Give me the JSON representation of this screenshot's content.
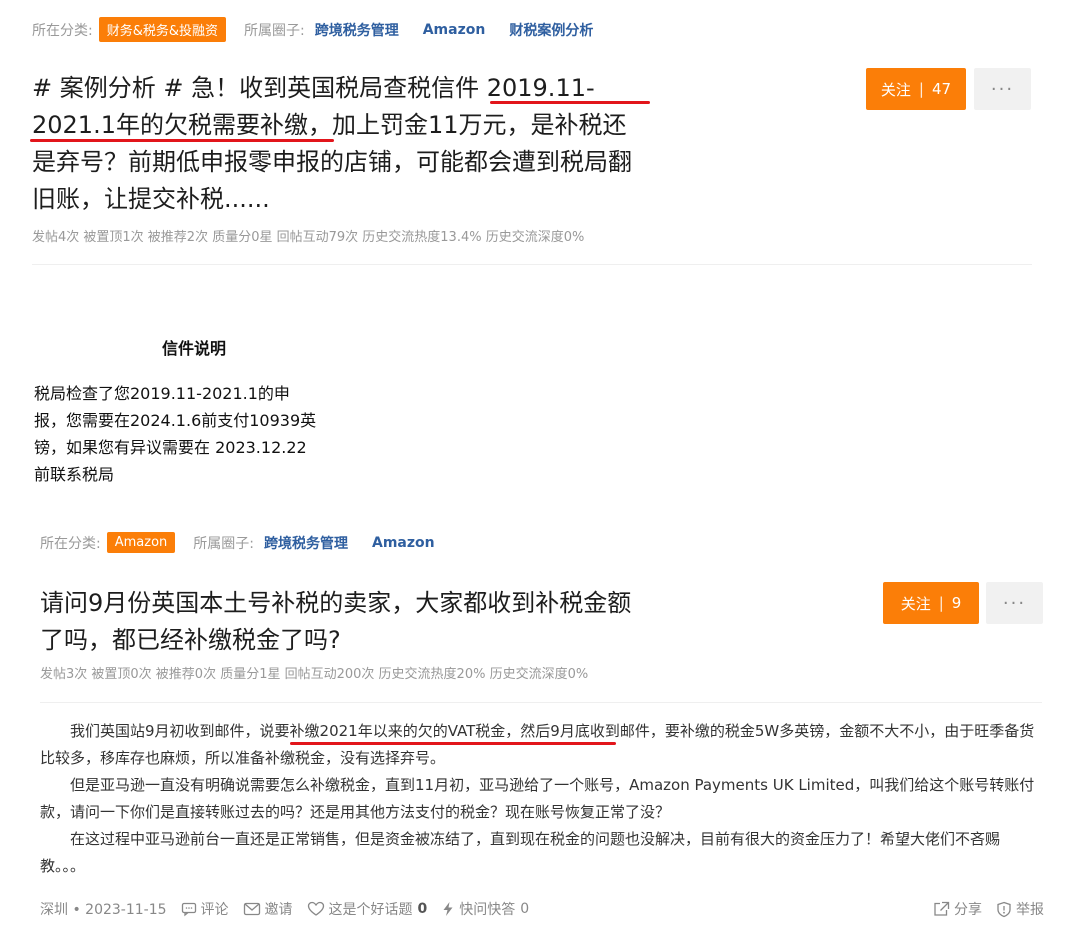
{
  "post1": {
    "category_label": "所在分类:",
    "category": "财务&税务&投融资",
    "circle_label": "所属圈子:",
    "tags": [
      "跨境税务管理",
      "Amazon",
      "财税案例分析"
    ],
    "title_lines": [
      "# 案例分析 # 急！收到英国税局查税信件 2019.11-",
      "2021.1年的欠税需要补缴，加上罚金11万元，是补税还",
      "是弃号？前期低申报零申报的店铺，可能都会遭到税局翻",
      "旧账，让提交补税......"
    ],
    "follow_label": "关注",
    "follow_count": "47",
    "more": "···",
    "stats": "发帖4次 被置顶1次 被推荐2次 质量分0星 回帖互动79次 历史交流热度13.4% 历史交流深度0%"
  },
  "letter": {
    "heading": "信件说明",
    "lines": [
      "税局检查了您2019.11-2021.1的申",
      "报，您需要在2024.1.6前支付10939英",
      "镑，如果您有异议需要在 2023.12.22",
      "前联系税局"
    ]
  },
  "post2": {
    "category_label": "所在分类:",
    "category": "Amazon",
    "circle_label": "所属圈子:",
    "tags": [
      "跨境税务管理",
      "Amazon"
    ],
    "title_lines": [
      "请问9月份英国本土号补税的卖家，大家都收到补税金额",
      "了吗，都已经补缴税金了吗?"
    ],
    "follow_label": "关注",
    "follow_count": "9",
    "more": "···",
    "stats": "发帖3次 被置顶0次 被推荐0次 质量分1星 回帖互动200次 历史交流热度20% 历史交流深度0%",
    "paragraphs": [
      "我们英国站9月初收到邮件，说要补缴2021年以来的欠的VAT税金，然后9月底收到邮件，要补缴的税金5W多英镑，金额不大不小，由于旺季备货比较多，移库存也麻烦，所以准备补缴税金，没有选择弃号。",
      "但是亚马逊一直没有明确说需要怎么补缴税金，直到11月初，亚马逊给了一个账号，Amazon Payments UK Limited，叫我们给这个账号转账付款，请问一下你们是直接转账过去的吗？还是用其他方法支付的税金？现在账号恢复正常了没？",
      "在这过程中亚马逊前台一直还是正常销售，但是资金被冻结了，直到现在税金的问题也没解决，目前有很大的资金压力了！希望大佬们不吝赐教。。。"
    ],
    "footer": {
      "location_date": "深圳 • 2023-11-15",
      "comment": "评论",
      "invite": "邀请",
      "good_topic": "这是个好话题",
      "good_topic_count": "0",
      "quick_qa": "快问快答",
      "quick_qa_count": "0",
      "share": "分享",
      "report": "举报"
    }
  },
  "colors": {
    "accent": "#fb7e08",
    "link": "#2f5fa0",
    "underline": "#e2151b"
  }
}
